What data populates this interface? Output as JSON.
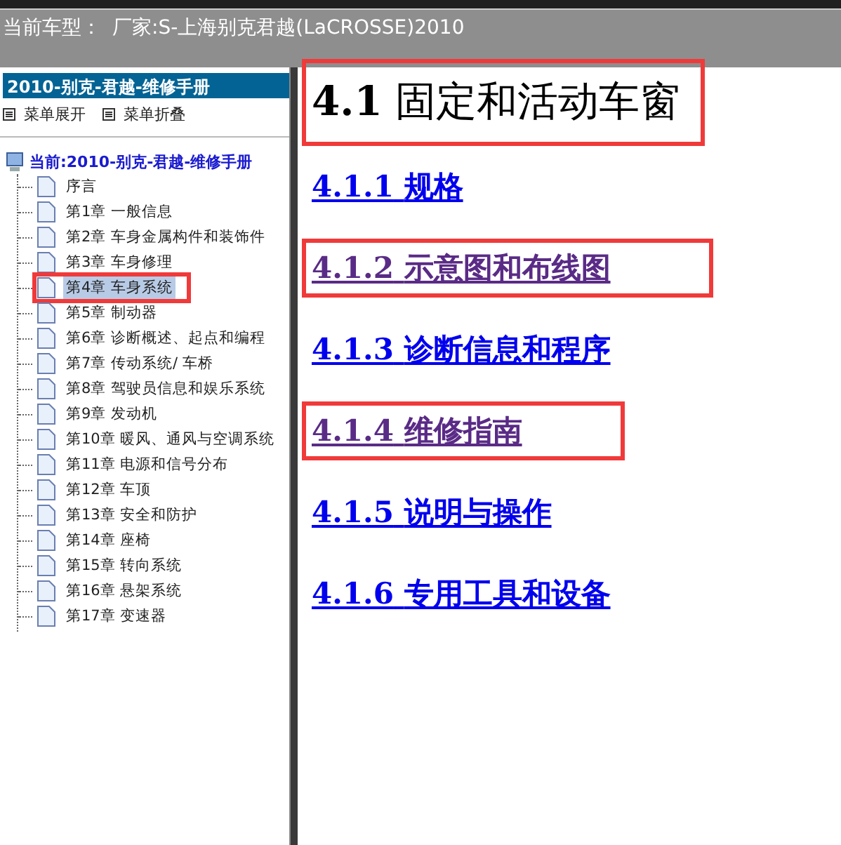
{
  "top_bar": {
    "label": "当前车型：",
    "value": "厂家:S-上海别克君越(LaCROSSE)2010"
  },
  "sidebar": {
    "title": "2010-别克-君越-维修手册",
    "menu_actions": [
      {
        "label": "菜单展开"
      },
      {
        "label": "菜单折叠"
      }
    ],
    "tree": {
      "label": "当前:2010-别克-君越-维修手册",
      "children": [
        {
          "label": "序言",
          "selected": false,
          "highlighted": false
        },
        {
          "label": "第1章 一般信息",
          "selected": false,
          "highlighted": false
        },
        {
          "label": "第2章 车身金属构件和装饰件",
          "selected": false,
          "highlighted": false
        },
        {
          "label": "第3章 车身修理",
          "selected": false,
          "highlighted": false
        },
        {
          "label": "第4章 车身系统",
          "selected": true,
          "highlighted": true
        },
        {
          "label": "第5章 制动器",
          "selected": false,
          "highlighted": false
        },
        {
          "label": "第6章 诊断概述、起点和编程",
          "selected": false,
          "highlighted": false
        },
        {
          "label": "第7章 传动系统/ 车桥",
          "selected": false,
          "highlighted": false
        },
        {
          "label": "第8章 驾驶员信息和娱乐系统",
          "selected": false,
          "highlighted": false
        },
        {
          "label": "第9章 发动机",
          "selected": false,
          "highlighted": false
        },
        {
          "label": "第10章 暖风、通风与空调系统",
          "selected": false,
          "highlighted": false
        },
        {
          "label": "第11章 电源和信号分布",
          "selected": false,
          "highlighted": false
        },
        {
          "label": "第12章 车顶",
          "selected": false,
          "highlighted": false
        },
        {
          "label": "第13章 安全和防护",
          "selected": false,
          "highlighted": false
        },
        {
          "label": "第14章 座椅",
          "selected": false,
          "highlighted": false
        },
        {
          "label": "第15章 转向系统",
          "selected": false,
          "highlighted": false
        },
        {
          "label": "第16章 悬架系统",
          "selected": false,
          "highlighted": false
        },
        {
          "label": "第17章 变速器",
          "selected": false,
          "highlighted": false
        }
      ]
    }
  },
  "content": {
    "title": {
      "number": "4.1",
      "text": "固定和活动车窗",
      "highlighted": true
    },
    "links": [
      {
        "number": "4.1.1",
        "text": "规格",
        "visited": false,
        "highlighted": false
      },
      {
        "number": "4.1.2",
        "text": "示意图和布线图",
        "visited": true,
        "highlighted": true
      },
      {
        "number": "4.1.3",
        "text": "诊断信息和程序",
        "visited": false,
        "highlighted": false
      },
      {
        "number": "4.1.4",
        "text": "维修指南",
        "visited": true,
        "highlighted": true
      },
      {
        "number": "4.1.5",
        "text": "说明与操作",
        "visited": false,
        "highlighted": false
      },
      {
        "number": "4.1.6",
        "text": "专用工具和设备",
        "visited": false,
        "highlighted": false
      }
    ]
  }
}
